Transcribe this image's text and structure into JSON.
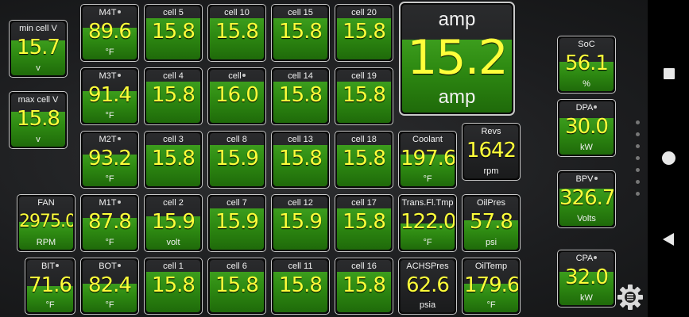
{
  "gauges": [
    {
      "label": "min cell V",
      "value": "15.7",
      "unit": "v",
      "fill": 0.65,
      "dot": false
    },
    {
      "label": "max cell V",
      "value": "15.8",
      "unit": "v",
      "fill": 0.65,
      "dot": false
    },
    {
      "label": "FAN",
      "value": "2975.0",
      "unit": "RPM",
      "fill": 0.52,
      "dot": false
    },
    {
      "label": "BIT",
      "value": "71.6",
      "unit": "°F",
      "fill": 0.5,
      "dot": true
    },
    {
      "label": "M4T",
      "value": "89.6",
      "unit": "°F",
      "fill": 0.6,
      "dot": true
    },
    {
      "label": "M3T",
      "value": "91.4",
      "unit": "°F",
      "fill": 0.6,
      "dot": true
    },
    {
      "label": "M2T",
      "value": "93.2",
      "unit": "°F",
      "fill": 0.6,
      "dot": true
    },
    {
      "label": "M1T",
      "value": "87.8",
      "unit": "°F",
      "fill": 0.6,
      "dot": true
    },
    {
      "label": "BOT",
      "value": "82.4",
      "unit": "°F",
      "fill": 0.55,
      "dot": true
    },
    {
      "label": "cell 5",
      "value": "15.8",
      "unit": "",
      "fill": 0.78,
      "dot": false
    },
    {
      "label": "cell 4",
      "value": "15.8",
      "unit": "",
      "fill": 0.78,
      "dot": false
    },
    {
      "label": "cell 3",
      "value": "15.8",
      "unit": "",
      "fill": 0.78,
      "dot": false
    },
    {
      "label": "cell 2",
      "value": "15.9",
      "unit": "volt",
      "fill": 0.62,
      "dot": false
    },
    {
      "label": "cell 1",
      "value": "15.8",
      "unit": "",
      "fill": 0.78,
      "dot": false
    },
    {
      "label": "cell 10",
      "value": "15.8",
      "unit": "",
      "fill": 0.78,
      "dot": false
    },
    {
      "label": "cell",
      "value": "16.0",
      "unit": "",
      "fill": 0.78,
      "dot": true
    },
    {
      "label": "cell 8",
      "value": "15.9",
      "unit": "",
      "fill": 0.78,
      "dot": false
    },
    {
      "label": "cell 7",
      "value": "15.9",
      "unit": "",
      "fill": 0.78,
      "dot": false
    },
    {
      "label": "cell 6",
      "value": "15.8",
      "unit": "",
      "fill": 0.78,
      "dot": false
    },
    {
      "label": "cell 15",
      "value": "15.8",
      "unit": "",
      "fill": 0.78,
      "dot": false
    },
    {
      "label": "cell 14",
      "value": "15.8",
      "unit": "",
      "fill": 0.78,
      "dot": false
    },
    {
      "label": "cell 13",
      "value": "15.8",
      "unit": "",
      "fill": 0.78,
      "dot": false
    },
    {
      "label": "cell 12",
      "value": "15.9",
      "unit": "",
      "fill": 0.78,
      "dot": false
    },
    {
      "label": "cell 11",
      "value": "15.8",
      "unit": "",
      "fill": 0.78,
      "dot": false
    },
    {
      "label": "cell 20",
      "value": "15.8",
      "unit": "",
      "fill": 0.78,
      "dot": false
    },
    {
      "label": "cell 19",
      "value": "15.8",
      "unit": "",
      "fill": 0.78,
      "dot": false
    },
    {
      "label": "cell 18",
      "value": "15.8",
      "unit": "",
      "fill": 0.78,
      "dot": false
    },
    {
      "label": "cell 17",
      "value": "15.8",
      "unit": "",
      "fill": 0.78,
      "dot": false
    },
    {
      "label": "cell 16",
      "value": "15.8",
      "unit": "",
      "fill": 0.78,
      "dot": false
    },
    {
      "label": "amp",
      "value": "15.2",
      "unit": "amp",
      "fill": 0.68,
      "dot": false
    },
    {
      "label": "Coolant",
      "value": "197.6",
      "unit": "°F",
      "fill": 0.6,
      "dot": false
    },
    {
      "label": "Trans.Fl.Tmp",
      "value": "122.0",
      "unit": "°F",
      "fill": 0.5,
      "dot": false
    },
    {
      "label": "ACHSPres",
      "value": "62.6",
      "unit": "psia",
      "fill": 0,
      "dot": false
    },
    {
      "label": "Revs",
      "value": "1642",
      "unit": "rpm",
      "fill": 0,
      "dot": false
    },
    {
      "label": "OilPres",
      "value": "57.8",
      "unit": "psi",
      "fill": 0.55,
      "dot": false
    },
    {
      "label": "OilTemp",
      "value": "179.6",
      "unit": "°F",
      "fill": 0.55,
      "dot": false
    },
    {
      "label": "SoC",
      "value": "56.1",
      "unit": "%",
      "fill": 0.55,
      "dot": false
    },
    {
      "label": "DPA",
      "value": "30.0",
      "unit": "kW",
      "fill": 0.68,
      "dot": true
    },
    {
      "label": "BPV",
      "value": "326.7",
      "unit": "Volts",
      "fill": 0.7,
      "dot": true
    },
    {
      "label": "CPA",
      "value": "32.0",
      "unit": "kW",
      "fill": 0.62,
      "dot": true
    }
  ],
  "icons": {
    "settings": "gear-icon",
    "recents": "square-icon",
    "home": "circle-icon",
    "back": "triangle-back-icon"
  }
}
